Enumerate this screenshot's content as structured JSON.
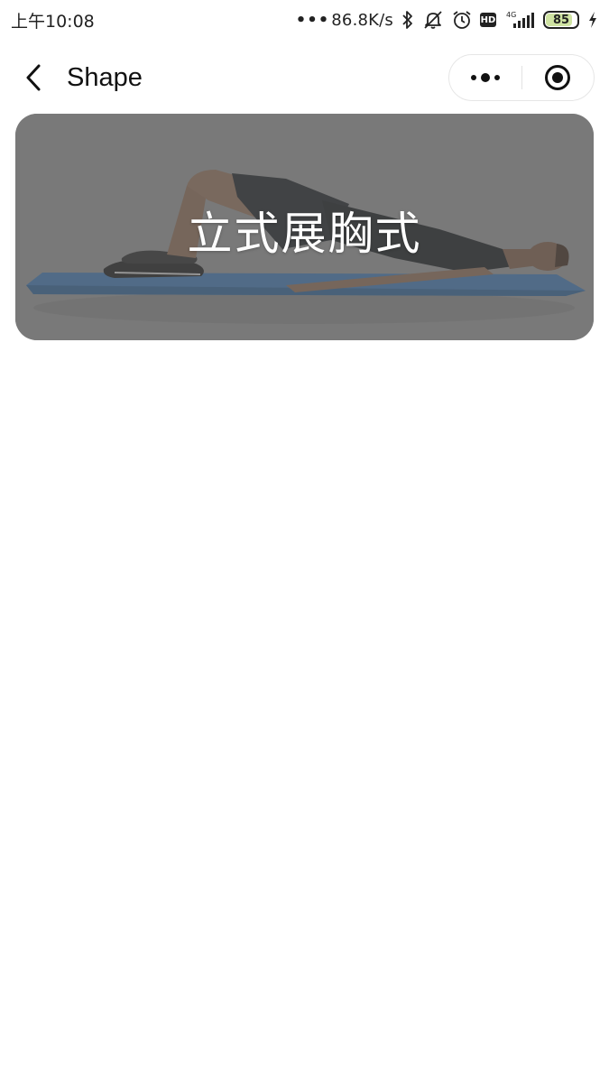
{
  "status_bar": {
    "time": "上午10:08",
    "net_speed": "86.8K/s",
    "signal_label": "4G",
    "hd_label": "HD",
    "battery_level": "85",
    "battery_percent": 85,
    "icons": [
      "bluetooth-icon",
      "mute-icon",
      "alarm-icon",
      "hd-icon",
      "signal-icon",
      "battery-icon",
      "charging-icon"
    ]
  },
  "nav": {
    "title": "Shape",
    "back_icon": "chevron-left-icon",
    "menu_icon": "more-dots-icon",
    "close_icon": "record-circle-icon"
  },
  "card": {
    "title": "立式展胸式",
    "image_subject": "person lying on mat doing glute bridge",
    "overlay_color": "#5a5a5a",
    "mat_color": "#4a78a8"
  },
  "colors": {
    "background": "#ffffff",
    "text_primary": "#111111",
    "card_text": "#ffffff"
  }
}
